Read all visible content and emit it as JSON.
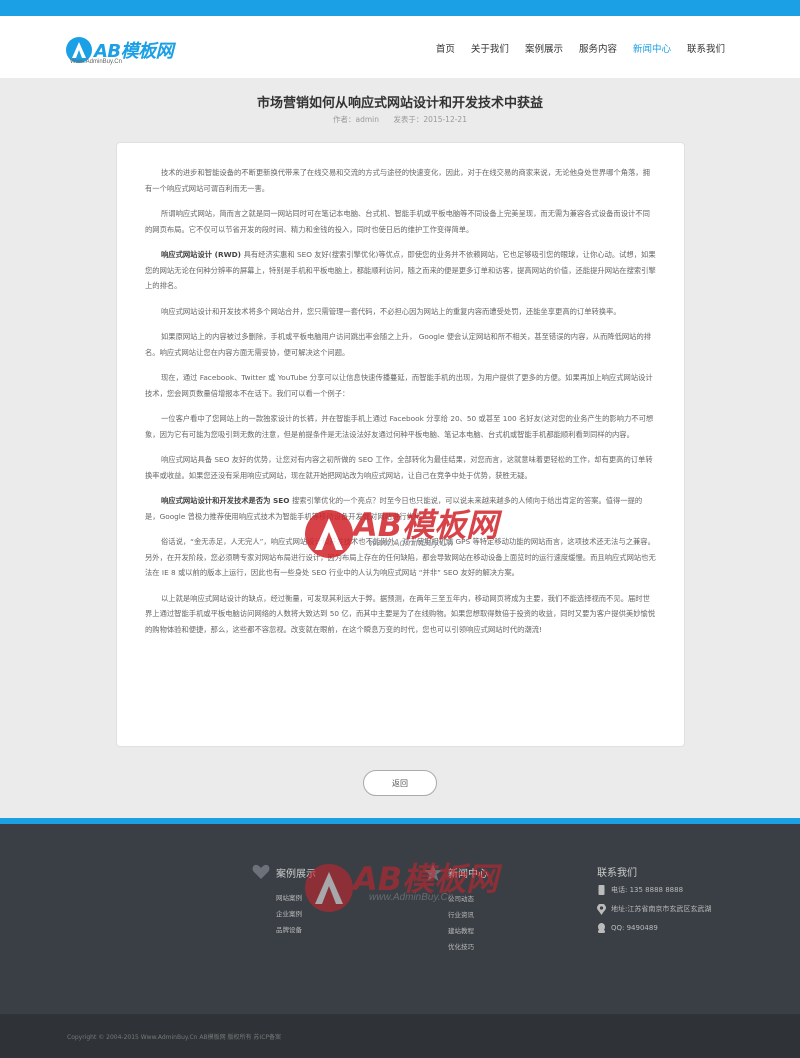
{
  "brand": {
    "name": "AB模板网",
    "url": "Www.AdminBuy.Cn",
    "color": "#1ba0e6"
  },
  "nav": [
    {
      "label": "首页",
      "active": false
    },
    {
      "label": "关于我们",
      "active": false
    },
    {
      "label": "案例展示",
      "active": false
    },
    {
      "label": "服务内容",
      "active": false
    },
    {
      "label": "新闻中心",
      "active": true
    },
    {
      "label": "联系我们",
      "active": false
    }
  ],
  "article": {
    "title": "市场营销如何从响应式网站设计和开发技术中获益",
    "author": "作者：admin",
    "date": "发表于：2015-12-21",
    "paragraphs": [
      {
        "bold": "",
        "text": "技术的进步和智能设备的不断更新换代带来了在线交易和交流的方式与途径的快速变化，因此，对于在线交易的商家来说，无论他身处世界哪个角落，拥有一个响应式网站可谓百利而无一害。"
      },
      {
        "bold": "",
        "text": "所谓响应式网站，简而言之就是同一网站同时可在笔记本电脑、台式机、智能手机或平板电脑等不同设备上完美呈现，而无需为兼容各式设备而设计不同的网页布局。它不仅可以节省开发的段时间、精力和金钱的投入，同时也使日后的维护工作变得简单。"
      },
      {
        "bold": "响应式网站设计 (RWD) ",
        "text": "具有经济实惠和 SEO 友好(搜索引擎优化)等优点，即使您的业务并不依赖网站，它也足够吸引您的眼球，让你心动。试想，如果您的网站无论在何种分辨率的屏幕上，特别是手机和平板电脑上，都能顺利访问，随之而来的便是更多订单和访客，提高网站的价值，还能提升网站在搜索引擎上的排名。"
      },
      {
        "bold": "",
        "text": "响应式网站设计和开发技术将多个网站合并，您只需管理一套代码，不必担心因为网站上的重复内容而遭受处罚，还能坐享更高的订单转换率。"
      },
      {
        "bold": "",
        "text": "如果原网站上的内容被过多删除，手机或平板电脑用户访问跳出率会随之上升， Google 便会认定网站和所不相关，甚至错误的内容，从而降低网站的排名。响应式网站让您在内容方面无需妥协，便可解决这个问题。"
      },
      {
        "bold": "",
        "text": "现在，通过 Facebook、Twitter 或 YouTube 分享可以让信息快速传播蔓延，而智能手机的出现，为用户提供了更多的方便。如果再加上响应式网站设计技术，您会网页数量倍增报本不在话下。我们可以看一个例子："
      },
      {
        "bold": "",
        "text": "一位客户看中了您网站上的一款独家设计的长裤，并在智能手机上通过 Facebook 分享给 20、50 或甚至 100 名好友(这对您的业务产生的影响力不可想象，因为它有可能为您吸引到无数的注意，但是前提条件是无法设法好友通过何种平板电脑、笔记本电脑、台式机或智能手机都能顺利看到同样的内容。"
      },
      {
        "bold": "",
        "text": "响应式网站具备 SEO 友好的优势，让您对有内容之初所做的 SEO 工作，全部转化为最佳结果，对您而言，这就意味着更轻松的工作，却有更高的订单转换率或收益。如果您还没有采用响应式网站，现在就开始把网站改为响应式网站，让自己在竞争中处于优势，获胜无疑。"
      },
      {
        "bold": "响应式网站设计和开发技术是否为 SEO ",
        "text": "搜索引擎优化的一个亮点？时至今日也只能说，可以说未来越来越多的人倾向于给出肯定的答案。值得一提的是，Google 曾极力推荐使用响应式技术为智能手机等移动设备开发或对网站进行优化。"
      },
      {
        "bold": "",
        "text": "俗话说，“金无赤足，人无完人”，响应式网站设计和开发技术也不能例外。对于使用相机或 GPS 等特定移动功能的网站而言，这项技术还无法与之兼容。另外，在开发阶段，您必须聘专家对网站布局进行设计，因为布局上存在的任何缺陷，都会导致网站在移动设备上面览时的运行速度缓慢。而且响应式网站也无法在 IE 8 或以前的版本上运行，因此也有一些身处 SEO 行业中的人认为响应式网站 “并非” SEO 友好的解决方案。"
      },
      {
        "bold": "",
        "text": "以上就是响应式网站设计的缺点，经过衡量，可发现其利远大于弊。据预测，在两年三至五年内，移动网页将成为主要，我们不能选择视而不见。届时世界上通过智能手机或平板电脑访问网络的人数将大致达到 50 亿，而其中主要是为了在线购物。如果您想取得数倍于投资的收益，同时又要为客户提供美妙愉悦的购物体验和便捷，那么，这些都不容忽视。改变就在眼前，在这个瞬息万变的时代，您也可以引领响应式网站时代的潮流!"
      }
    ]
  },
  "back_label": "返回",
  "footer": {
    "cases": {
      "title": "案例展示",
      "items": [
        "网站案例",
        "企业案例",
        "品牌设备"
      ]
    },
    "news": {
      "title": "新闻中心",
      "items": [
        "公司动态",
        "行业资讯",
        "建站教程",
        "优化技巧"
      ]
    },
    "contact": {
      "title": "联系我们",
      "phone": "电话: 135 8888 8888",
      "address": "地址:江苏省南京市玄武区玄武湖",
      "qq": "QQ: 9490489"
    },
    "copyright": "Copyright © 2004-2015 Www.AdminBuy.Cn AB模板网 版权所有 苏ICP备案"
  },
  "watermark": {
    "text": "AB模板网",
    "sub": "www.AdminBuy.Cn"
  }
}
